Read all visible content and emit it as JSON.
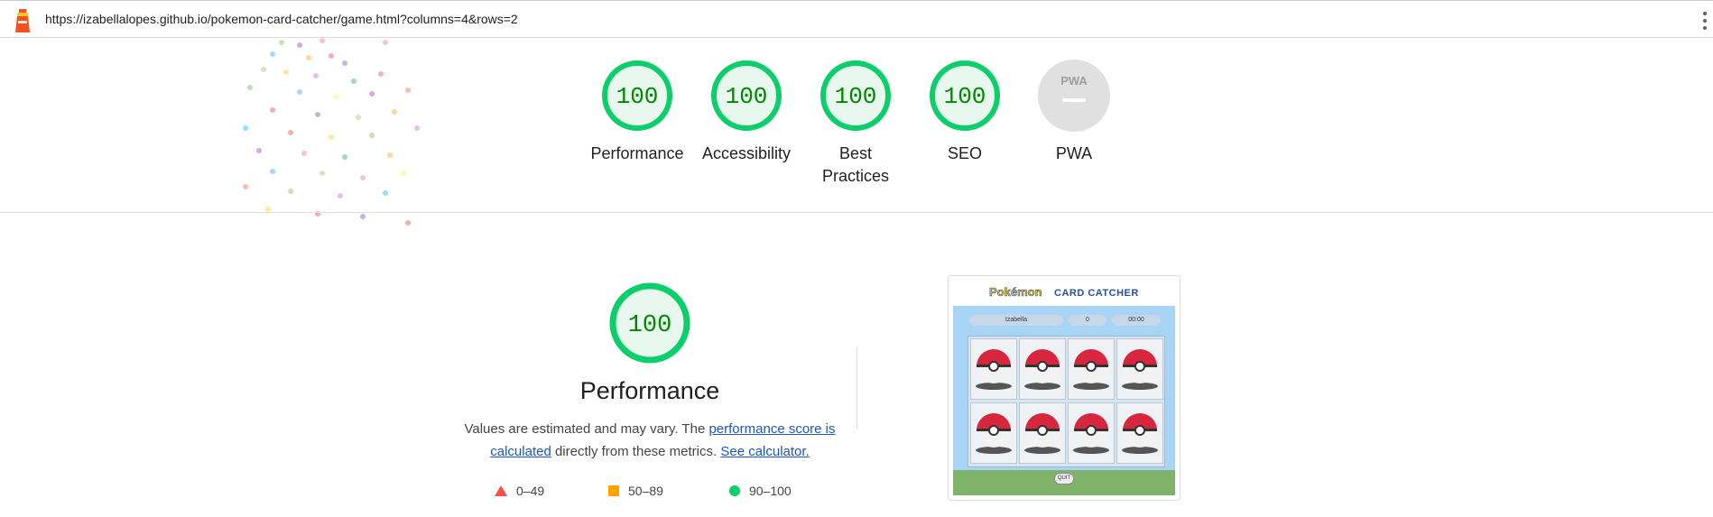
{
  "browser": {
    "url": "https://izabellalopes.github.io/pokemon-card-catcher/game.html?columns=4&rows=2"
  },
  "scores": [
    {
      "label": "Performance",
      "value": "100"
    },
    {
      "label": "Accessibility",
      "value": "100"
    },
    {
      "label": "Best Practices",
      "value": "100"
    },
    {
      "label": "SEO",
      "value": "100"
    },
    {
      "label": "PWA",
      "value": "PWA"
    }
  ],
  "performance": {
    "score": "100",
    "title": "Performance",
    "desc_prefix": "Values are estimated and may vary. The ",
    "link1": "performance score is calculated",
    "desc_middle": " directly from these metrics. ",
    "link2": "See calculator."
  },
  "legend": {
    "fail": "0–49",
    "average": "50–89",
    "pass": "90–100"
  },
  "screenshot": {
    "logo": "Pokémon",
    "title": "CARD CATCHER",
    "player": "Izabella",
    "score": "0",
    "time": "00:00",
    "quit": "QUIT"
  },
  "colors": {
    "pass": "#0cce6b",
    "pass_text": "#008800",
    "average": "#ffa400",
    "fail": "#ff4e42",
    "link": "#1a56c7"
  }
}
